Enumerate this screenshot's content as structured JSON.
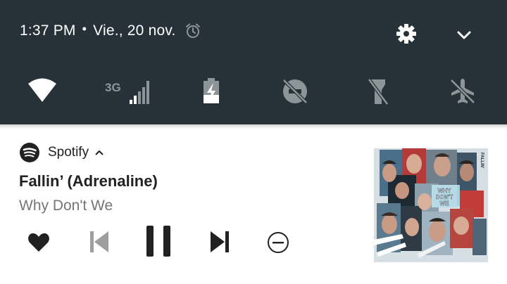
{
  "status_bar": {
    "time": "1:37 PM",
    "separator": "•",
    "date": "Vie., 20 nov."
  },
  "quick_settings": {
    "network_type": "3G"
  },
  "notification": {
    "app_name": "Spotify",
    "track_title": "Fallin’ (Adrenaline)",
    "artist": "Why Don't We",
    "album_art_text": "WHY DON'T WE",
    "album_side_text": "FALLIN'"
  },
  "colors": {
    "shade_bg": "#263238",
    "icon_white": "#ffffff",
    "icon_dim": "#8e9599",
    "notification_bg": "#ffffff",
    "control_dark": "#212121",
    "control_disabled": "#9e9e9e"
  },
  "icons": [
    "alarm-icon",
    "gear-icon",
    "chevron-down-icon",
    "wifi-icon",
    "cellular-3g-icon",
    "battery-charging-icon",
    "do-not-disturb-off-icon",
    "flashlight-off-icon",
    "airplane-mode-off-icon",
    "spotify-logo-icon",
    "chevron-up-icon",
    "heart-icon",
    "skip-previous-icon",
    "pause-icon",
    "skip-next-icon",
    "minus-circle-icon"
  ]
}
